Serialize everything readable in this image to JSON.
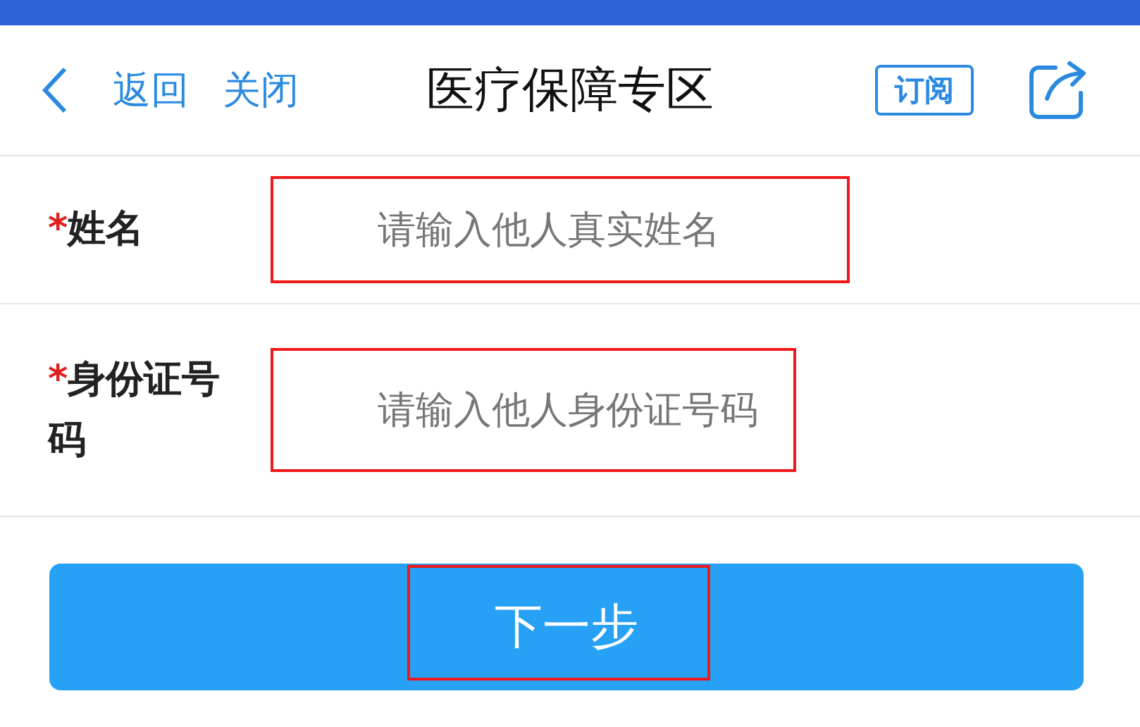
{
  "nav": {
    "back": "返回",
    "close": "关闭",
    "title": "医疗保障专区",
    "subscribe": "订阅"
  },
  "fields": [
    {
      "required_mark": "*",
      "label": "姓名",
      "placeholder": "请输入他人真实姓名"
    },
    {
      "required_mark": "*",
      "label": "身份证号码",
      "placeholder": "请输入他人身份证号码"
    }
  ],
  "next_button": "下一步"
}
